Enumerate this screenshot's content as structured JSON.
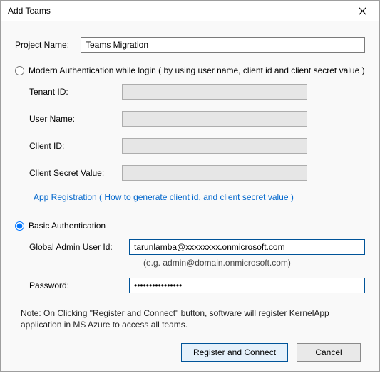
{
  "window": {
    "title": "Add Teams"
  },
  "project": {
    "label": "Project Name:",
    "value": "Teams Migration"
  },
  "modern": {
    "radio_label": "Modern Authentication while login ( by using user name, client id and client secret value )",
    "selected": false,
    "tenant_label": "Tenant ID:",
    "tenant_value": "",
    "username_label": "User Name:",
    "username_value": "",
    "clientid_label": "Client ID:",
    "clientid_value": "",
    "clientsecret_label": "Client Secret Value:",
    "clientsecret_value": "",
    "link_text": "App Registration ( How to generate client id, and client secret value )"
  },
  "basic": {
    "radio_label": "Basic Authentication",
    "selected": true,
    "userid_label": "Global Admin User Id:",
    "userid_value": "tarunlamba@xxxxxxxx.onmicrosoft.com",
    "hint": "(e.g. admin@domain.onmicrosoft.com)",
    "password_label": "Password:",
    "password_value": "••••••••••••••••"
  },
  "note": "Note: On Clicking \"Register and Connect\" button, software will register KernelApp application in MS Azure to access all teams.",
  "buttons": {
    "primary": "Register and Connect",
    "cancel": "Cancel"
  }
}
